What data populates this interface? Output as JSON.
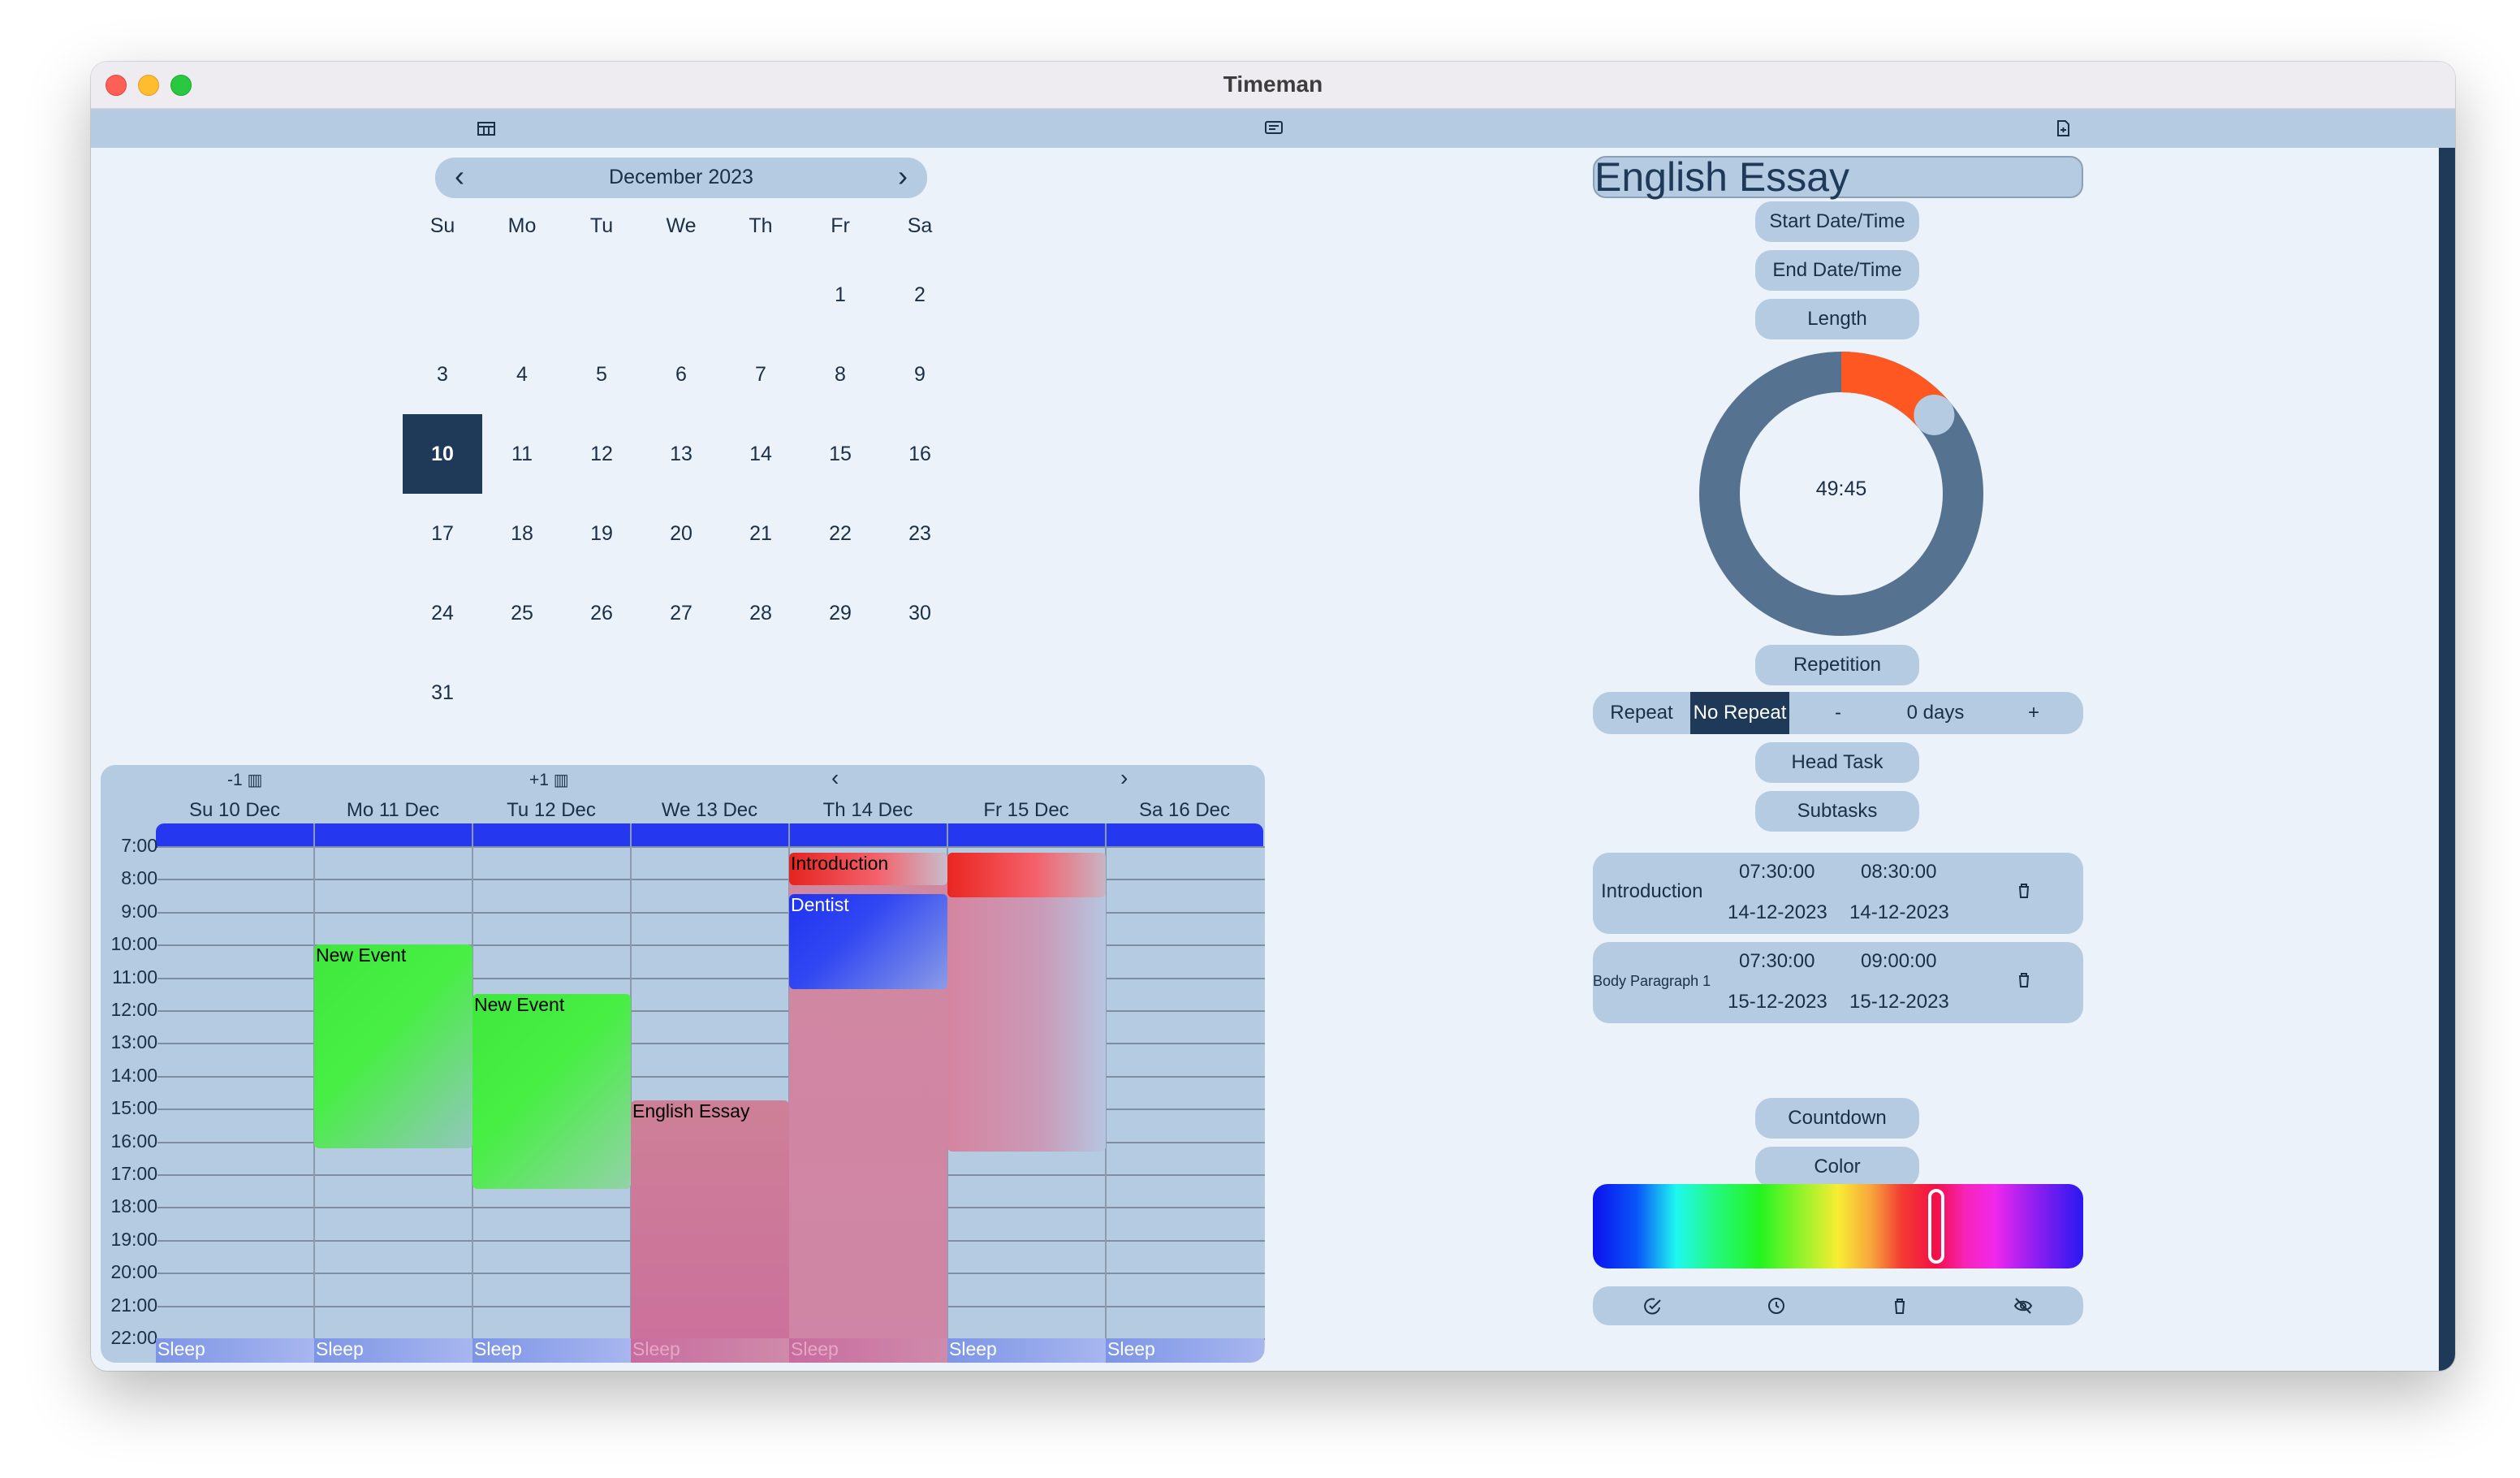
{
  "window": {
    "title": "Timeman"
  },
  "toolbar": {
    "icons": [
      "calendar-icon",
      "message-icon",
      "document-icon"
    ]
  },
  "month": {
    "label": "December 2023",
    "weekdays": [
      "Su",
      "Mo",
      "Tu",
      "We",
      "Th",
      "Fr",
      "Sa"
    ],
    "weeks": [
      [
        "",
        "",
        "",
        "",
        "",
        "1",
        "2"
      ],
      [
        "3",
        "4",
        "5",
        "6",
        "7",
        "8",
        "9"
      ],
      [
        "10",
        "11",
        "12",
        "13",
        "14",
        "15",
        "16"
      ],
      [
        "17",
        "18",
        "19",
        "20",
        "21",
        "22",
        "23"
      ],
      [
        "24",
        "25",
        "26",
        "27",
        "28",
        "29",
        "30"
      ],
      [
        "31",
        "",
        "",
        "",
        "",
        "",
        ""
      ]
    ],
    "selected_day": "10"
  },
  "week": {
    "prev_week_label": "-1",
    "next_week_label": "+1",
    "prev_day": "‹",
    "next_day": "›",
    "days": [
      "Su 10 Dec",
      "Mo 11 Dec",
      "Tu 12 Dec",
      "We 13 Dec",
      "Th 14 Dec",
      "Fr 15 Dec",
      "Sa 16 Dec"
    ],
    "hours": [
      "7:00",
      "8:00",
      "9:00",
      "10:00",
      "11:00",
      "12:00",
      "13:00",
      "14:00",
      "15:00",
      "16:00",
      "17:00",
      "18:00",
      "19:00",
      "20:00",
      "21:00",
      "22:00"
    ],
    "events": [
      {
        "title": "New Event",
        "day": 1,
        "start": 10,
        "end": 16.2,
        "fill": "linear-gradient(135deg,#3fe83d 0%,#48ee44 45%,#93c6bd 100%)",
        "text": "dark"
      },
      {
        "title": "New Event",
        "day": 2,
        "start": 11.5,
        "end": 17.45,
        "fill": "linear-gradient(135deg,#3fe83d 0%,#48ee44 45%,#93d2a8 100%)",
        "text": "dark"
      },
      {
        "title": "English Essay",
        "day": 3,
        "start": 14.75,
        "end": 22.8,
        "fill": "linear-gradient(to bottom,#cd8097,#cc6f9c)",
        "text": "dark"
      },
      {
        "title": "",
        "day": 4,
        "start": 7.2,
        "end": 22.8,
        "fill": "linear-gradient(to bottom,#d0879f,#cf86a6)",
        "text": "dark"
      },
      {
        "title": "Introduction",
        "day": 4,
        "start": 7.2,
        "end": 8.2,
        "fill": "linear-gradient(to right,#e52420,#f4606a 55%,#c7bccc)",
        "text": "dark"
      },
      {
        "title": "Dentist",
        "day": 4,
        "start": 8.45,
        "end": 11.35,
        "fill": "linear-gradient(135deg,#1f33ef 0%,#3147f2 40%,#8a9ce6 100%)",
        "text": "light"
      },
      {
        "title": "Body Paragraph 1",
        "day": 5,
        "start": 7.2,
        "end": 16.3,
        "fill": "linear-gradient(to right,#d5849f 0%,#c99bb8 60%,#b6c6e0 100%)",
        "text": "dark"
      },
      {
        "title": "",
        "day": 5,
        "start": 7.2,
        "end": 8.55,
        "fill": "linear-gradient(to right,#ea2620,#f4606a 55%,#c8b4c4)",
        "text": "dark"
      }
    ],
    "sleep_label": "Sleep"
  },
  "task": {
    "title": "English Essay",
    "buttons": {
      "start": "Start Date/Time",
      "end": "End Date/Time",
      "length": "Length",
      "repetition": "Repetition",
      "head_task": "Head Task",
      "subtasks": "Subtasks",
      "countdown": "Countdown",
      "color": "Color"
    },
    "length_value": "49:45",
    "length_fraction": 0.138,
    "repeat": {
      "label": "Repeat",
      "mode": "No Repeat",
      "minus": "-",
      "days": "0 days",
      "plus": "+"
    },
    "subtasks": [
      {
        "name": "Introduction",
        "start_time": "07:30:00",
        "end_time": "08:30:00",
        "start_date": "14-12-2023",
        "end_date": "14-12-2023"
      },
      {
        "name": "Body Paragraph 1",
        "start_time": "07:30:00",
        "end_time": "09:00:00",
        "start_date": "15-12-2023",
        "end_date": "15-12-2023"
      }
    ],
    "color_hue_fraction": 0.7,
    "bottom_icons": [
      "mark-done-icon",
      "clock-icon",
      "trash-icon",
      "hide-icon"
    ]
  },
  "colors": {
    "accent_dark": "#1e3a58",
    "panel": "#b5cbe2",
    "background": "#ecf2f9",
    "dial_track": "#557390",
    "dial_progress": "#fe5722"
  }
}
